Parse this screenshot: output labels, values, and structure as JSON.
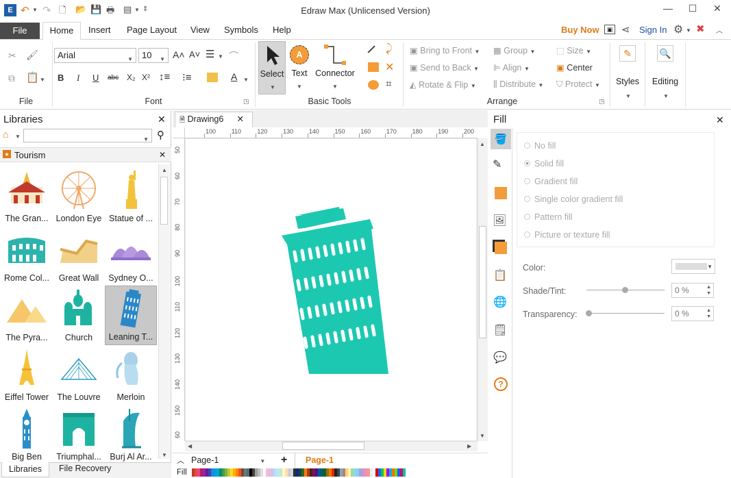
{
  "window": {
    "title": "Edraw Max (Unlicensed Version)",
    "minimize": "—",
    "maximize": "☐",
    "close": "✕"
  },
  "menu": {
    "file": "File",
    "tabs": [
      "Home",
      "Insert",
      "Page Layout",
      "View",
      "Symbols",
      "Help"
    ],
    "buy_now": "Buy Now",
    "sign_in": "Sign In"
  },
  "ribbon": {
    "file_group": "File",
    "font_group": "Font",
    "font_name": "Arial",
    "font_size": "10",
    "basic_tools_group": "Basic Tools",
    "select": "Select",
    "text": "Text",
    "connector": "Connector",
    "arrange_group": "Arrange",
    "bring_to_front": "Bring to Front",
    "send_to_back": "Send to Back",
    "rotate_flip": "Rotate & Flip",
    "group": "Group",
    "align": "Align",
    "distribute": "Distribute",
    "size": "Size",
    "center": "Center",
    "protect": "Protect",
    "styles": "Styles",
    "editing": "Editing"
  },
  "libraries": {
    "title": "Libraries",
    "category": "Tourism",
    "items": [
      "The Gran...",
      "London Eye",
      "Statue of ...",
      "Rome Col...",
      "Great Wall",
      "Sydney O...",
      "The Pyra...",
      "Church",
      "Leaning T...",
      "Eiffel Tower",
      "The Louvre",
      "Merloin",
      "Big Ben",
      "Triumphal...",
      "Burj Al Ar..."
    ],
    "bottom_tabs": [
      "Libraries",
      "File Recovery"
    ]
  },
  "document": {
    "tab": "Drawing6",
    "ruler_top": [
      "100",
      "110",
      "120",
      "130",
      "140",
      "150",
      "160",
      "170",
      "180",
      "190",
      "200"
    ],
    "ruler_left": [
      "50",
      "60",
      "70",
      "80",
      "90",
      "100",
      "110",
      "120",
      "130",
      "140",
      "150",
      "60"
    ],
    "page_select": "Page-1",
    "active_page": "Page-1",
    "fill_label": "Fill"
  },
  "fill_panel": {
    "title": "Fill",
    "options": [
      "No fill",
      "Solid fill",
      "Gradient fill",
      "Single color gradient fill",
      "Pattern fill",
      "Picture or texture fill"
    ],
    "color_label": "Color:",
    "shade_label": "Shade/Tint:",
    "shade_value": "0 %",
    "transparency_label": "Transparency:",
    "transparency_value": "0 %"
  },
  "colors": {
    "tower": "#1dc8b0",
    "accent_orange": "#f39c12",
    "selected_lib": "#c8c8c8"
  }
}
